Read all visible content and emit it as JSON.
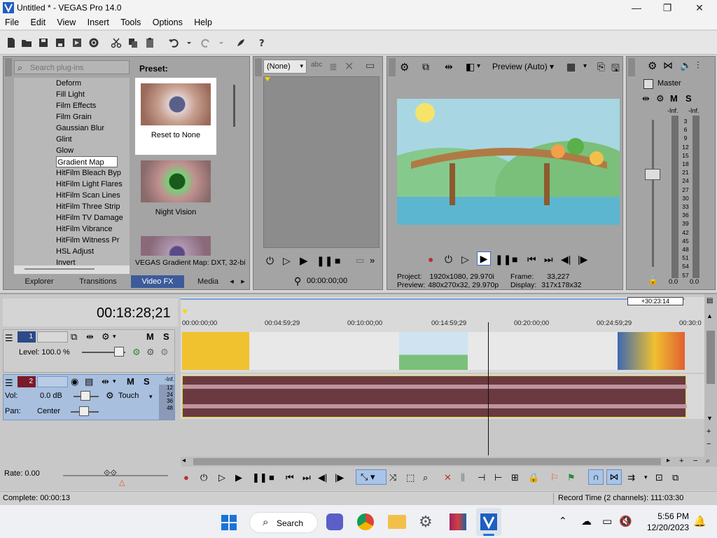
{
  "window": {
    "title": "Untitled * - VEGAS Pro 14.0",
    "minimize": "—",
    "maximize": "❐",
    "close": "✕"
  },
  "menu": [
    "File",
    "Edit",
    "View",
    "Insert",
    "Tools",
    "Options",
    "Help"
  ],
  "plugins": {
    "search_placeholder": "Search plug-ins",
    "preset_label": "Preset:",
    "items": [
      "Deform",
      "Fill Light",
      "Film Effects",
      "Film Grain",
      "Gaussian Blur",
      "Glint",
      "Glow",
      "Gradient Map",
      "HitFilm Bleach Byp",
      "HitFilm Light Flares",
      "HitFilm Scan Lines",
      "HitFilm Three Strip",
      "HitFilm TV Damage",
      "HitFilm Vibrance",
      "HitFilm Witness Pr",
      "HSL Adjust",
      "Invert"
    ],
    "selected": "Gradient Map",
    "presets": [
      "Reset to None",
      "Night Vision"
    ],
    "description": "VEGAS Gradient Map: DXT, 32-bi",
    "tabs": [
      "Explorer",
      "Transitions",
      "Video FX",
      "Media"
    ],
    "active_tab": "Video FX"
  },
  "trimmer": {
    "dropdown": "(None)",
    "timecode": "00:00:00;00"
  },
  "preview": {
    "mode": "Preview (Auto)",
    "project_label": "Project:",
    "project_value": "1920x1080, 29.970i",
    "preview_label": "Preview:",
    "preview_value": "480x270x32, 29.970p",
    "frame_label": "Frame:",
    "frame_value": "33,227",
    "display_label": "Display:",
    "display_value": "317x178x32"
  },
  "mixer": {
    "master_label": "Master",
    "m": "M",
    "s": "S",
    "inf_left": "-Inf.",
    "inf_right": "-Inf.",
    "scale": [
      "3",
      "6",
      "9",
      "12",
      "15",
      "18",
      "21",
      "24",
      "27",
      "30",
      "33",
      "36",
      "39",
      "42",
      "45",
      "48",
      "51",
      "54",
      "57"
    ],
    "bottom_left": "0.0",
    "bottom_right": "0.0"
  },
  "timeline": {
    "time_display": "00:18:28;21",
    "end_marker": "+30:23:14",
    "ruler": [
      "00:00:00;00",
      "00:04:59;29",
      "00:10:00;00",
      "00:14:59;29",
      "00:20:00;00",
      "00:24:59;29",
      "00:30:0"
    ],
    "video_track": {
      "number": "1",
      "level": "Level: 100.0 %",
      "m": "M",
      "s": "S"
    },
    "audio_track": {
      "number": "2",
      "vol_label": "Vol:",
      "vol_value": "0.0 dB",
      "pan_label": "Pan:",
      "pan_value": "Center",
      "touch": "Touch",
      "m": "M",
      "s": "S",
      "meter": [
        "-Inf.",
        "12",
        "24",
        "36",
        "48"
      ]
    },
    "rate": "Rate: 0.00"
  },
  "status": {
    "complete": "Complete: 00:00:13",
    "record_time": "Record Time (2 channels): 111:03:30"
  },
  "taskbar": {
    "search": "Search",
    "time": "5:56 PM",
    "date": "12/20/2023"
  }
}
